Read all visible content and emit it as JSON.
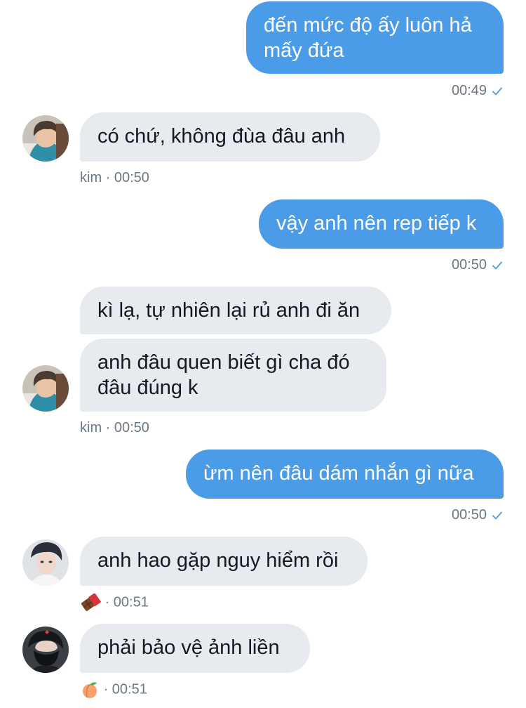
{
  "messages": [
    {
      "text": "đến mức độ ấy luôn hả mấy đứa",
      "time": "00:49"
    },
    {
      "text": "có chứ, không đùa đâu anh",
      "sender": "kim",
      "meta": "kim · 00:50"
    },
    {
      "text": "vậy anh nên rep tiếp k",
      "time": "00:50"
    },
    {
      "text": "kì lạ, tự nhiên lại rủ anh đi ăn"
    },
    {
      "text": "anh đâu quen biết gì cha đó đâu đúng k",
      "sender": "kim",
      "meta": "kim · 00:50"
    },
    {
      "text": "ừm nên đâu dám nhắn gì nữa",
      "time": "00:50"
    },
    {
      "text": "anh hao gặp nguy hiểm rồi",
      "meta": "· 00:51"
    },
    {
      "text": "phải bảo vệ ảnh liền",
      "meta": "· 00:51"
    }
  ],
  "icons": {
    "read_check": "checkmark-icon",
    "sender_emoji_1": "chocolate-bar-icon",
    "sender_emoji_2": "peach-icon"
  },
  "colors": {
    "outgoing_bubble": "#4a9be8",
    "incoming_bubble": "#e7eaef",
    "meta_text": "#6b7884",
    "check": "#4a9be8"
  }
}
